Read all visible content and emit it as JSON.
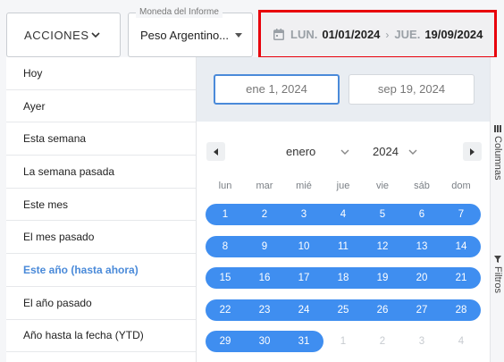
{
  "toolbar": {
    "actions_label": "ACCIONES",
    "currency_label": "Moneda del Informe",
    "currency_value": "Peso Argentino...",
    "range": {
      "start_dow": "LUN.",
      "start_date": "01/01/2024",
      "separator": "›",
      "end_dow": "JUE.",
      "end_date": "19/09/2024"
    }
  },
  "presets": [
    {
      "label": "Hoy",
      "active": false
    },
    {
      "label": "Ayer",
      "active": false
    },
    {
      "label": "Esta semana",
      "active": false
    },
    {
      "label": "La semana pasada",
      "active": false
    },
    {
      "label": "Este mes",
      "active": false
    },
    {
      "label": "El mes pasado",
      "active": false
    },
    {
      "label": "Este año (hasta ahora)",
      "active": true
    },
    {
      "label": "El año pasado",
      "active": false
    },
    {
      "label": "Año hasta la fecha (YTD)",
      "active": false
    }
  ],
  "calendar": {
    "start_input": "ene 1, 2024",
    "end_input": "sep 19, 2024",
    "month": "enero",
    "year": "2024",
    "weekdays": [
      "lun",
      "mar",
      "mié",
      "jue",
      "vie",
      "sáb",
      "dom"
    ],
    "weeks": [
      [
        {
          "d": "1",
          "in": true
        },
        {
          "d": "2",
          "in": true
        },
        {
          "d": "3",
          "in": true
        },
        {
          "d": "4",
          "in": true
        },
        {
          "d": "5",
          "in": true
        },
        {
          "d": "6",
          "in": true
        },
        {
          "d": "7",
          "in": true
        }
      ],
      [
        {
          "d": "8",
          "in": true
        },
        {
          "d": "9",
          "in": true
        },
        {
          "d": "10",
          "in": true
        },
        {
          "d": "11",
          "in": true
        },
        {
          "d": "12",
          "in": true
        },
        {
          "d": "13",
          "in": true
        },
        {
          "d": "14",
          "in": true
        }
      ],
      [
        {
          "d": "15",
          "in": true
        },
        {
          "d": "16",
          "in": true
        },
        {
          "d": "17",
          "in": true
        },
        {
          "d": "18",
          "in": true
        },
        {
          "d": "19",
          "in": true
        },
        {
          "d": "20",
          "in": true
        },
        {
          "d": "21",
          "in": true
        }
      ],
      [
        {
          "d": "22",
          "in": true
        },
        {
          "d": "23",
          "in": true
        },
        {
          "d": "24",
          "in": true
        },
        {
          "d": "25",
          "in": true
        },
        {
          "d": "26",
          "in": true
        },
        {
          "d": "27",
          "in": true
        },
        {
          "d": "28",
          "in": true
        }
      ],
      [
        {
          "d": "29",
          "in": true
        },
        {
          "d": "30",
          "in": true
        },
        {
          "d": "31",
          "in": true
        },
        {
          "d": "1",
          "in": false
        },
        {
          "d": "2",
          "in": false
        },
        {
          "d": "3",
          "in": false
        },
        {
          "d": "4",
          "in": false
        }
      ]
    ]
  },
  "side_tabs": {
    "columns": "Columnas",
    "filters": "Filtros"
  },
  "colors": {
    "accent": "#3f8ef0",
    "highlight_border": "#e8000b",
    "active_preset": "#4a8ad9"
  }
}
